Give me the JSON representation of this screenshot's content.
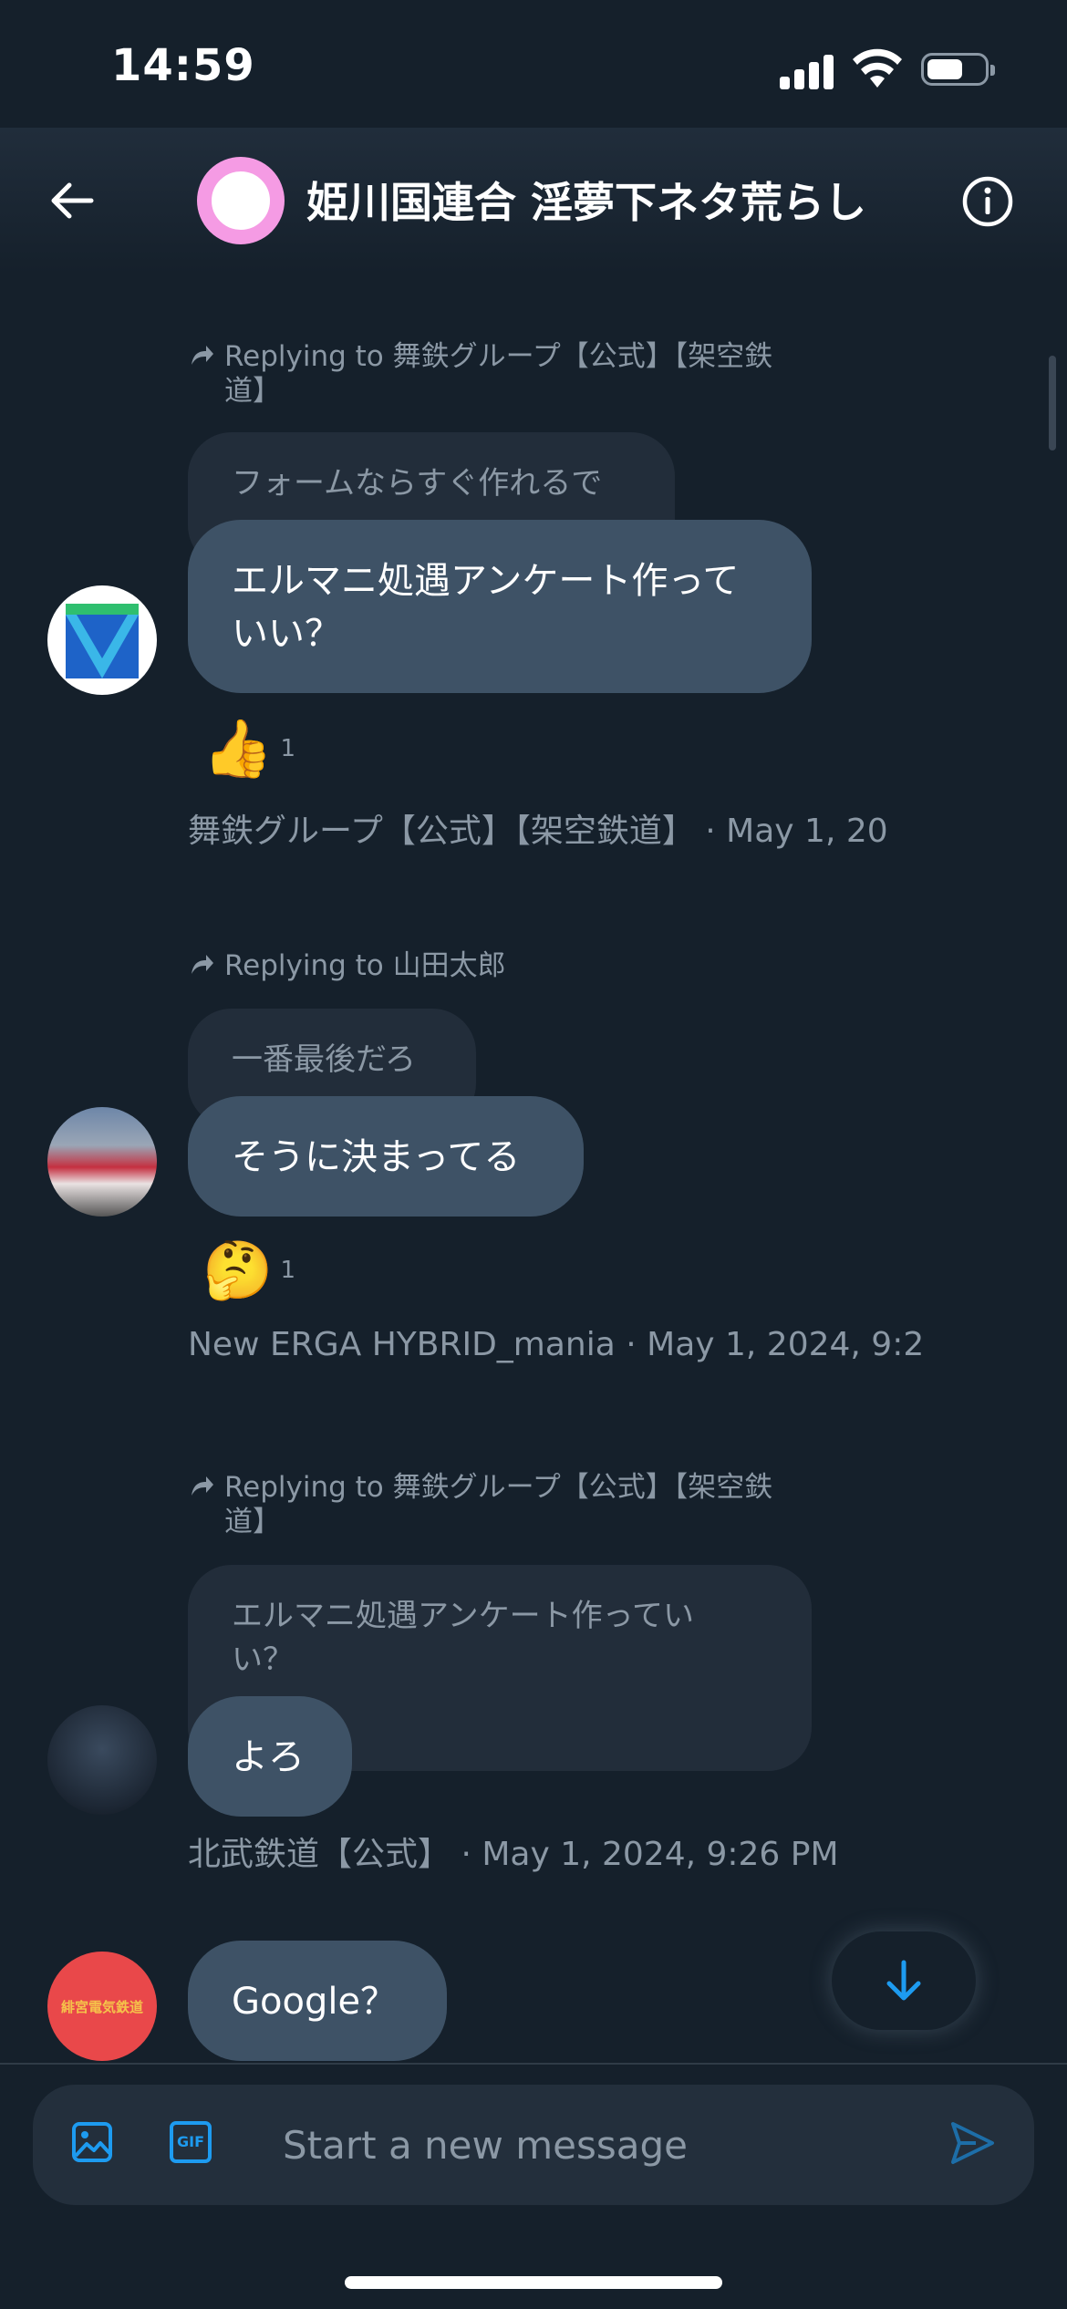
{
  "status_bar": {
    "time": "14:59"
  },
  "header": {
    "title": "姫川国連合 淫夢下ネタ荒らし",
    "avatar_colors": [
      "#f59be4",
      "#ffffff"
    ]
  },
  "messages": [
    {
      "reply_to": "Replying to 舞鉄グループ【公式】【架空鉄道】",
      "quoted_text": "フォームならすぐ作れるで",
      "text": "エルマニ処遇アンケート作っていい？",
      "reaction_emoji": "👍",
      "reaction_count": "1",
      "meta": "舞鉄グループ【公式】【架空鉄道】 · May 1, 20"
    },
    {
      "reply_to": "Replying to 山田太郎",
      "quoted_text": "一番最後だろ",
      "text": "そうに決まってる",
      "reaction_emoji": "🤔",
      "reaction_count": "1",
      "meta": "New ERGA HYBRID_mania · May 1, 2024, 9:2"
    },
    {
      "reply_to": "Replying to 舞鉄グループ【公式】【架空鉄道】",
      "quoted_text": "エルマニ処遇アンケート作っていい？",
      "text": "よろ",
      "meta": "北武鉄道【公式】 · May 1, 2024, 9:26 PM"
    },
    {
      "text": "Google？",
      "avatar_text": "緋宮電気鉄道"
    }
  ],
  "composer": {
    "placeholder": "Start a new message",
    "gif_label": "GIF"
  },
  "colors": {
    "background": "#15202b",
    "bubble": "#3e5266",
    "quote": "#222d3a",
    "accent": "#1d9bf0",
    "muted": "#8b98a5"
  }
}
